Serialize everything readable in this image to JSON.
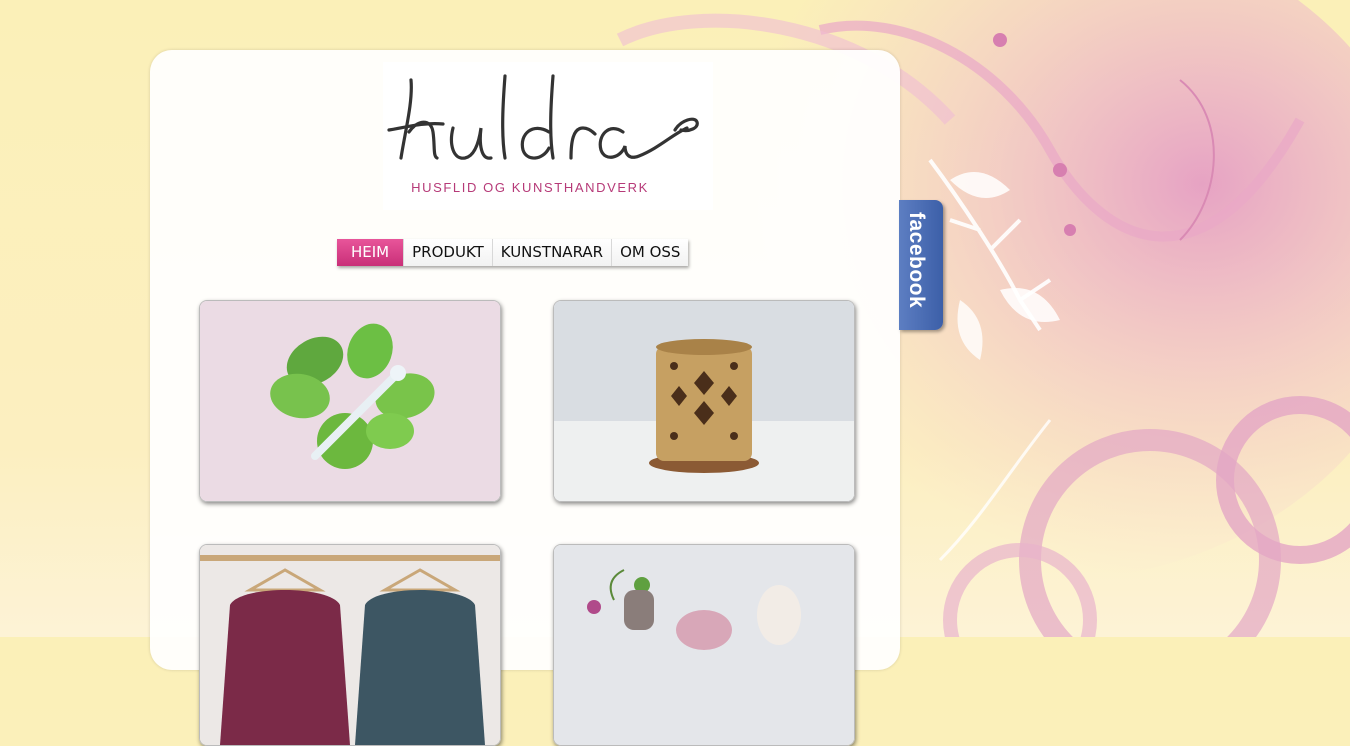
{
  "brand": {
    "logo_text": "huldra",
    "tagline": "HUSFLID OG KUNSTHANDVERK"
  },
  "nav": {
    "items": [
      {
        "label": "HEIM",
        "active": true
      },
      {
        "label": "PRODUKT",
        "active": false
      },
      {
        "label": "KUNSTNARAR",
        "active": false
      },
      {
        "label": "OM OSS",
        "active": false
      }
    ]
  },
  "social": {
    "facebook_label": "facebook"
  },
  "products": [
    {
      "subject": "green glass butterfly"
    },
    {
      "subject": "ceramic lantern"
    },
    {
      "subject": "knitted shawls"
    },
    {
      "subject": "small vases with flowers"
    }
  ],
  "colors": {
    "accent": "#c92f78",
    "background": "#fbf0b8",
    "facebook": "#3c5fa8"
  }
}
